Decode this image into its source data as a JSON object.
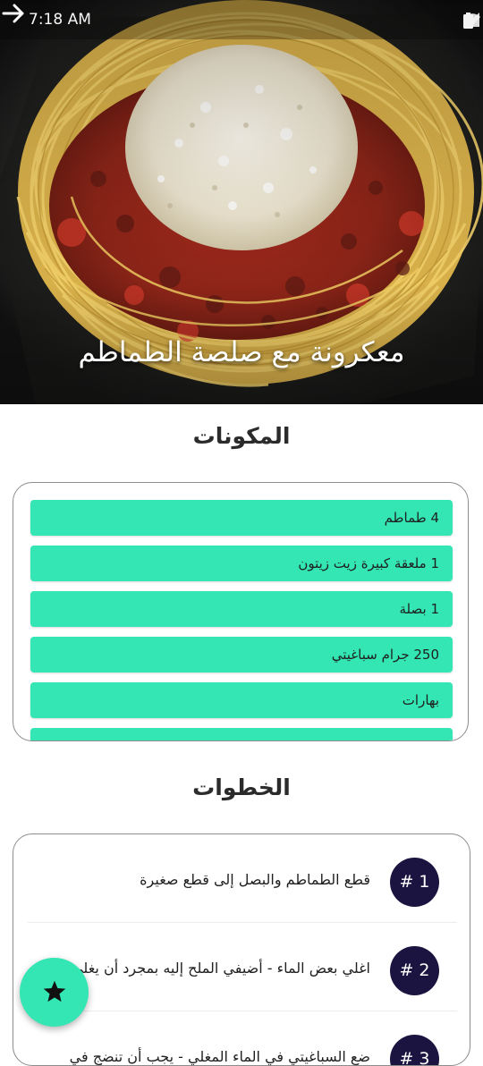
{
  "status_bar": {
    "time": "7:18 AM",
    "icons": [
      "wifi-icon",
      "signal-icon",
      "battery-icon"
    ]
  },
  "header": {
    "back_icon": "arrow-right-icon"
  },
  "recipe": {
    "title": "معكرونة مع صلصة الطماطم"
  },
  "ingredients": {
    "heading": "المكونات",
    "items": [
      "4 طماطم",
      "1 ملعقة كبيرة زيت زيتون",
      "1 بصلة",
      "250 جرام سباغيتي",
      "بهارات"
    ]
  },
  "steps": {
    "heading": "الخطوات",
    "items": [
      {
        "badge": "# 1",
        "text": "قطع الطماطم والبصل إلى قطع صغيرة"
      },
      {
        "badge": "# 2",
        "text": "اغلي بعض الماء - أضيفي الملح إليه بمجرد أن يغلي."
      },
      {
        "badge": "# 3",
        "text": "ضع السباغيتي في الماء المغلي - يجب أن تنضج في"
      }
    ]
  },
  "fab": {
    "icon": "star-icon"
  },
  "colors": {
    "accent": "#33e6b3",
    "badge": "#1c1440",
    "card_border": "#8c8c8c",
    "text": "#1f1f1f"
  }
}
